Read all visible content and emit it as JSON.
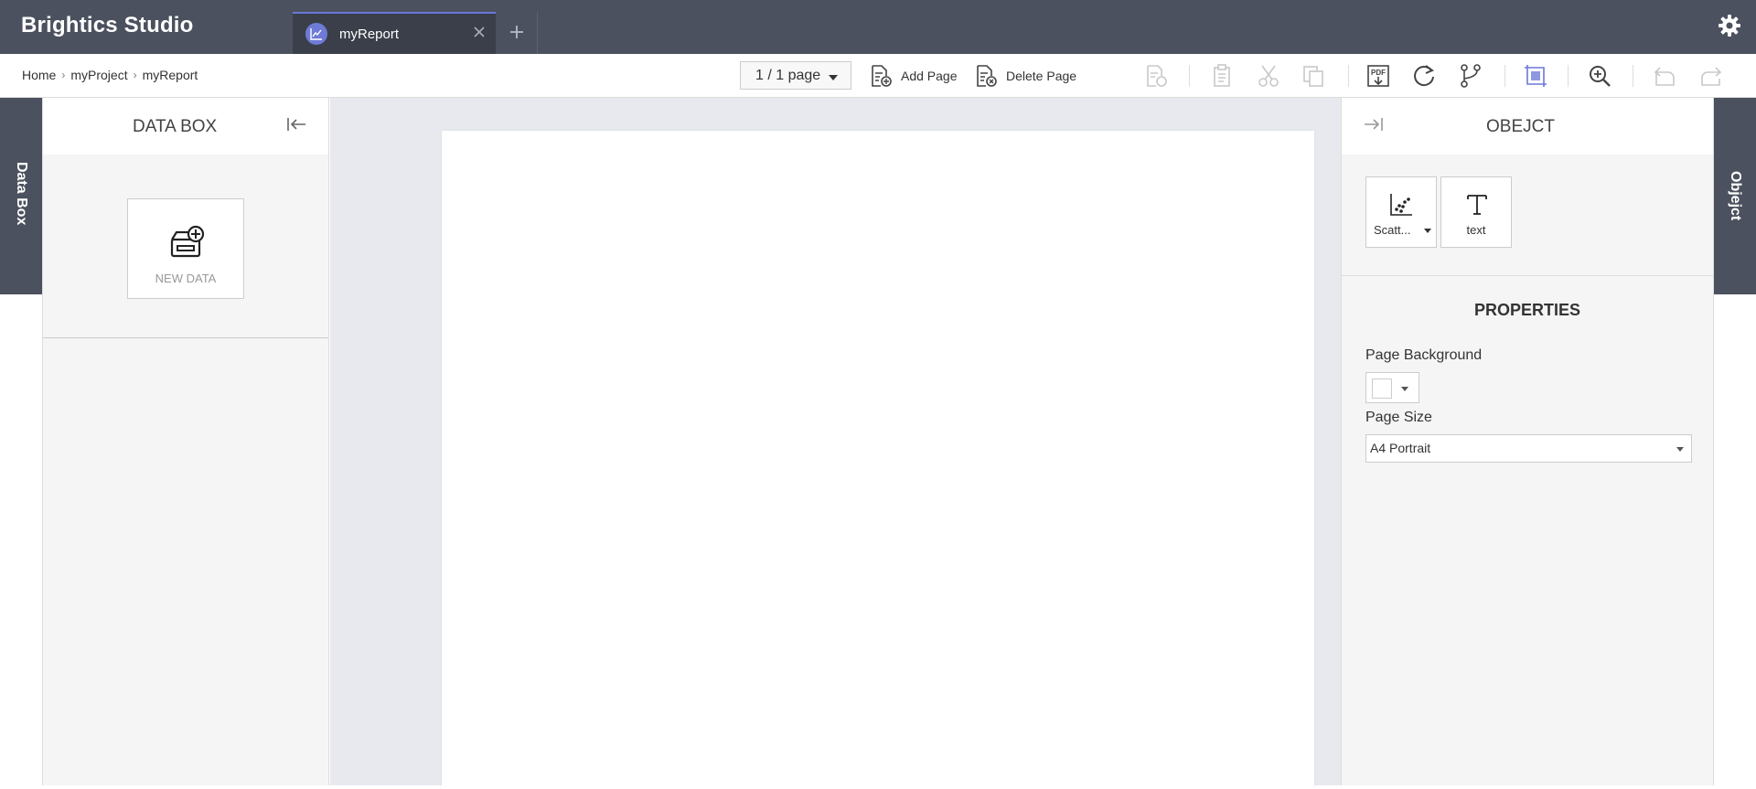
{
  "app": {
    "title": "Brightics Studio"
  },
  "tabs": [
    {
      "label": "myReport",
      "icon": "line-chart-icon",
      "active": true
    }
  ],
  "breadcrumb": {
    "items": [
      "Home",
      "myProject",
      "myReport"
    ]
  },
  "toolbar": {
    "page_indicator": "1 / 1 page",
    "add_page_label": "Add Page",
    "delete_page_label": "Delete Page",
    "icons": [
      "page-settings-icon",
      "paste-icon",
      "cut-icon",
      "copy-icon",
      "export-pdf-icon",
      "refresh-icon",
      "branch-icon",
      "fit-page-icon",
      "zoom-in-icon",
      "undo-icon",
      "redo-icon"
    ]
  },
  "left_rail": {
    "label": "Data Box"
  },
  "databox": {
    "title": "DATA BOX",
    "new_data_label": "NEW DATA"
  },
  "object_panel": {
    "title": "OBEJCT",
    "objects": [
      {
        "label": "Scatt...",
        "icon": "scatter-chart-icon"
      },
      {
        "label": "text",
        "icon": "text-icon"
      }
    ]
  },
  "properties": {
    "title": "PROPERTIES",
    "page_background_label": "Page Background",
    "page_background_color": "#ffffff",
    "page_size_label": "Page Size",
    "page_size_value": "A4 Portrait"
  },
  "right_rail": {
    "label": "Objejct"
  },
  "colors": {
    "header": "#4b515e",
    "accent": "#6b78d8",
    "canvas": "#e7e9ef"
  }
}
